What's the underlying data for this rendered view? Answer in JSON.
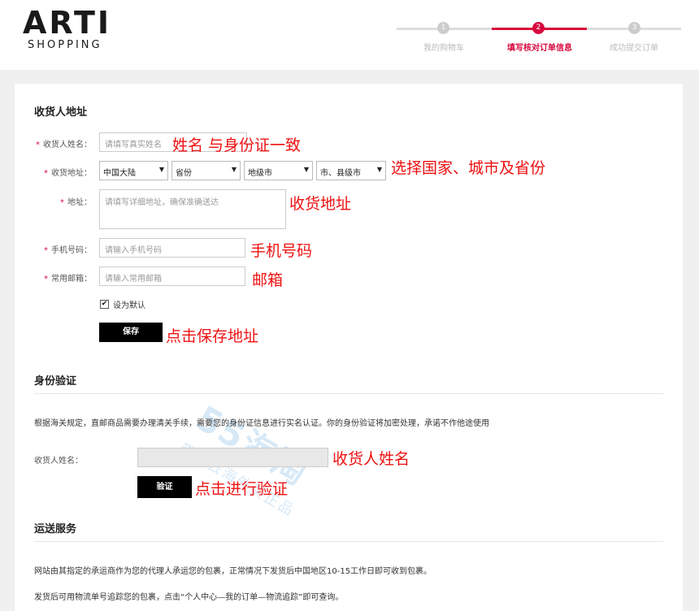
{
  "logo": {
    "main": "ARTI",
    "sub": "SHOPPING"
  },
  "steps": [
    {
      "num": "1",
      "label": "我的购物车"
    },
    {
      "num": "2",
      "label": "填写核对订单信息"
    },
    {
      "num": "3",
      "label": "成功提交订单"
    }
  ],
  "colors": {
    "accent": "#d8083c",
    "annotation": "#ee1111",
    "button": "#000000"
  },
  "address": {
    "title": "收货人地址",
    "name_label": "收货人姓名：",
    "name_placeholder": "请填写真实姓名",
    "region_label": "收货地址：",
    "country": "中国大陆",
    "province": "省份",
    "city": "地级市",
    "district": "市、县级市",
    "detail_label": "地址：",
    "detail_placeholder": "请填写详细地址，确保准确送达",
    "phone_label": "手机号码：",
    "phone_placeholder": "请输入手机号码",
    "email_label": "常用邮箱：",
    "email_placeholder": "请输入常用邮箱",
    "default_label": "设为默认",
    "default_checked": true,
    "save_label": "保存"
  },
  "identity": {
    "title": "身份验证",
    "desc": "根据海关规定，直邮商品需要办理清关手续，需要您的身份证信息进行实名认证。你的身份验证将加密处理，承诺不作他途使用",
    "name_label": "收货人姓名：",
    "verify_label": "验证"
  },
  "shipping": {
    "title": "运送服务",
    "line1": "网站由其指定的承运商作为您的代理人承运您的包裹，正常情况下发货后中国地区10-15工作日即可收到包裹。",
    "line2": "发货后可用物流单号追踪您的包裹，点击“个人中心—我的订单—物流追踪”即可查询。"
  },
  "annotations": {
    "name": "姓名 与身份证一致",
    "region": "选择国家、城市及省份",
    "address": "收货地址",
    "phone": "手机号码",
    "email": "邮箱",
    "save": "点击保存地址",
    "id_name": "收货人姓名",
    "verify": "点击进行验证"
  },
  "watermark": {
    "main": "55海淘",
    "sub": "带你去海外买正品"
  }
}
